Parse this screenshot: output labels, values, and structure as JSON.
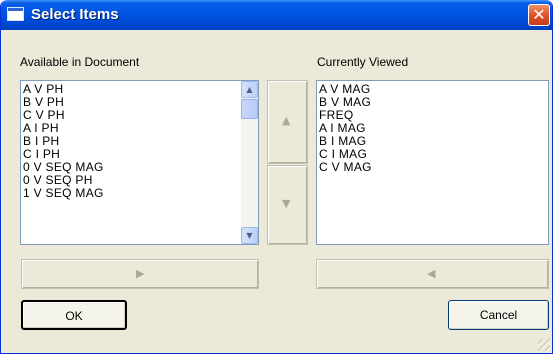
{
  "window": {
    "title": "Select Items",
    "close_glyph": "✕"
  },
  "available": {
    "label": "Available in Document",
    "items": [
      "A V PH",
      "B V PH",
      "C V PH",
      "A I PH",
      "B I PH",
      "C I PH",
      "0 V SEQ MAG",
      "0 V SEQ PH",
      "1 V SEQ MAG"
    ]
  },
  "current": {
    "label": "Currently Viewed",
    "items": [
      "A V MAG",
      "B V MAG",
      "FREQ",
      "A I MAG",
      "B I MAG",
      "C I MAG",
      "C V MAG"
    ]
  },
  "buttons": {
    "ok_label": "OK",
    "cancel_label": "Cancel"
  },
  "icons": {
    "move_up": "triangle-up-icon",
    "move_down": "triangle-down-icon",
    "add": "triangle-right-icon",
    "remove": "triangle-left-icon",
    "scroll_up": "chevron-up-icon",
    "scroll_down": "chevron-down-icon"
  },
  "colors": {
    "titlebar": "#0055e5",
    "dialog_bg": "#ece9d8",
    "close_button": "#e0532c"
  }
}
